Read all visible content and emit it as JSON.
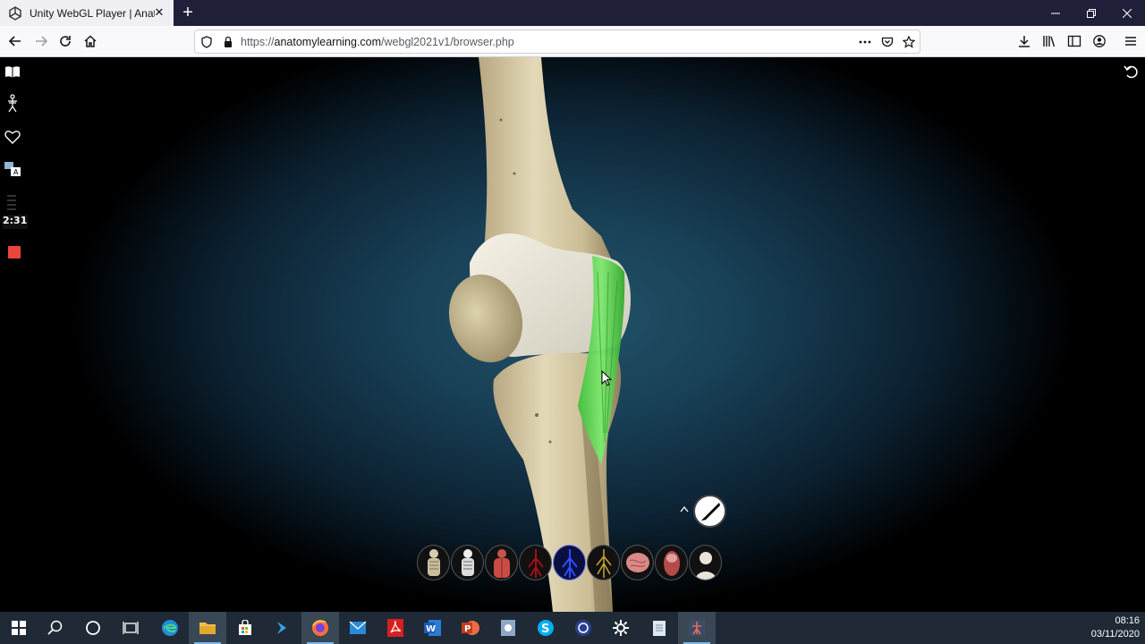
{
  "browser": {
    "tab_title": "Unity WebGL Player | Anatomy",
    "tab_close": "✕",
    "new_tab": "+",
    "url_prefix": "https://",
    "url_domain": "anatomylearning.com",
    "url_path": "/webgl2021v1/browser.php",
    "window_controls": [
      "minimize",
      "restore",
      "close"
    ]
  },
  "app": {
    "timer": "2:31",
    "left_tools": [
      "book-icon",
      "skeleton-icon",
      "heart-icon",
      "translate-icon"
    ],
    "layer_buttons": [
      {
        "name": "skeleton-layer"
      },
      {
        "name": "ligaments-layer"
      },
      {
        "name": "muscles-layer"
      },
      {
        "name": "arteries-layer"
      },
      {
        "name": "veins-layer"
      },
      {
        "name": "nerves-layer"
      },
      {
        "name": "brain-layer"
      },
      {
        "name": "organs-layer"
      },
      {
        "name": "skin-layer"
      }
    ],
    "accent_green": "#4fd34a",
    "record_color": "#e9473b"
  },
  "taskbar": {
    "time": "08:16",
    "date": "03/11/2020",
    "apps": [
      "windows-start",
      "search",
      "cortana",
      "task-view",
      "edge",
      "file-explorer",
      "store",
      "visual-studio",
      "firefox",
      "mail",
      "acrobat",
      "word",
      "powerpoint",
      "app",
      "skype",
      "obs",
      "settings",
      "notepad",
      "anatomy-app"
    ]
  }
}
